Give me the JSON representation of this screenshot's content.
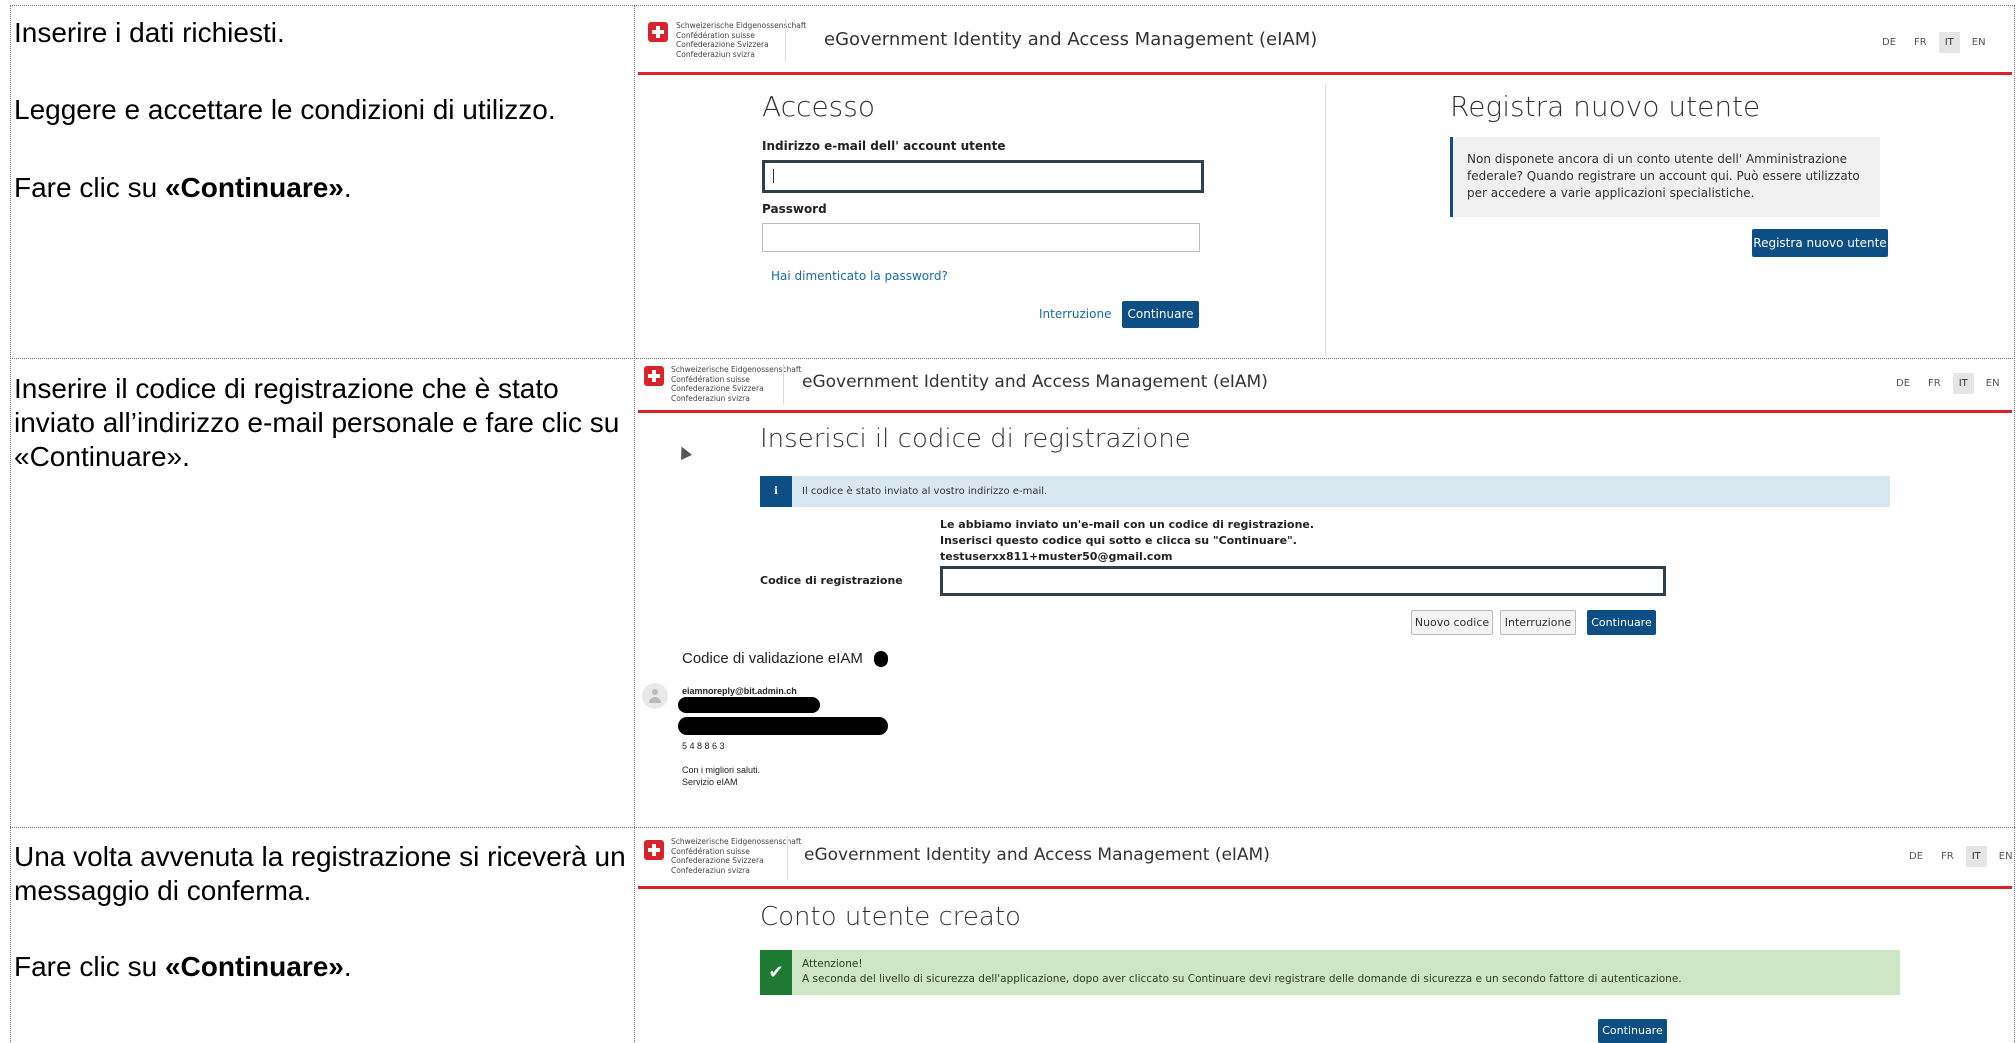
{
  "rows": [
    {
      "instructions": {
        "line1": "Inserire i dati richiesti.",
        "line2": "Leggere e accettare le condizioni di utilizzo.",
        "line3_prefix": "Fare clic su ",
        "line3_bold": "«Continuare»",
        "line3_suffix": "."
      },
      "screen": {
        "confederation": [
          "Schweizerische Eidgenossenschaft",
          "Confédération suisse",
          "Confederazione Svizzera",
          "Confederaziun svizra"
        ],
        "app_title": "eGovernment Identity and Access Management (eIAM)",
        "languages": [
          "DE",
          "FR",
          "IT",
          "EN"
        ],
        "active_language": "IT",
        "login_heading": "Accesso",
        "email_label": "Indirizzo e-mail dell' account utente",
        "email_value": "",
        "password_label": "Password",
        "password_value": "",
        "forgot_password": "Hai dimenticato la password?",
        "cancel_link": "Interruzione",
        "continue_button": "Continuare",
        "register_heading": "Registra nuovo utente",
        "register_text": "Non disponete ancora di un conto utente dell' Amministrazione federale? Quando registrare un account qui. Può essere utilizzato per accedere a varie applicazioni specialistiche.",
        "register_button": "Registra nuovo utente"
      }
    },
    {
      "instructions": {
        "text": "Inserire il codice di registrazione che è stato inviato all’indirizzo e-mail personale e fare clic su «Continuare»."
      },
      "screen": {
        "confederation": [
          "Schweizerische Eidgenossenschaft",
          "Confédération suisse",
          "Confederazione Svizzera",
          "Confederaziun svizra"
        ],
        "app_title": "eGovernment Identity and Access Management (eIAM)",
        "languages": [
          "DE",
          "FR",
          "IT",
          "EN"
        ],
        "active_language": "IT",
        "heading": "Inserisci il codice di registrazione",
        "info_icon": "i",
        "info_message": "Il codice è stato inviato al vostro indirizzo e-mail.",
        "sent_line1": "Le abbiamo inviato un'e-mail con un codice di registrazione.",
        "sent_line2": "Inserisci questo codice qui sotto e clicca su \"Continuare\".",
        "sent_email": "testuserxx811+muster50@gmail.com",
        "code_label": "Codice di registrazione",
        "code_value": "",
        "new_code_button": "Nuovo codice",
        "cancel_button": "Interruzione",
        "continue_button": "Continuare",
        "email_preview": {
          "subject": "Codice di validazione eIAM",
          "sender": "eiamnoreply@bit.admin.ch",
          "code": "5 4 8 8 6 3",
          "closing1": "Con i migliori saluti.",
          "closing2": "Servizio eIAM"
        }
      }
    },
    {
      "instructions": {
        "line1": "Una volta avvenuta la registrazione si riceverà un messaggio di conferma.",
        "line2_prefix": "Fare clic su ",
        "line2_bold": "«Continuare»",
        "line2_suffix": "."
      },
      "screen": {
        "confederation": [
          "Schweizerische Eidgenossenschaft",
          "Confédération suisse",
          "Confederazione Svizzera",
          "Confederaziun svizra"
        ],
        "app_title": "eGovernment Identity and Access Management (eIAM)",
        "languages": [
          "DE",
          "FR",
          "IT",
          "EN"
        ],
        "active_language": "IT",
        "heading": "Conto utente creato",
        "alert_title": "Attenzione!",
        "alert_text": "A seconda del livello di sicurezza dell'applicazione, dopo aver cliccato su Continuare devi registrare delle domande di sicurezza e un secondo fattore di autenticazione.",
        "continue_button": "Continuare"
      }
    }
  ]
}
